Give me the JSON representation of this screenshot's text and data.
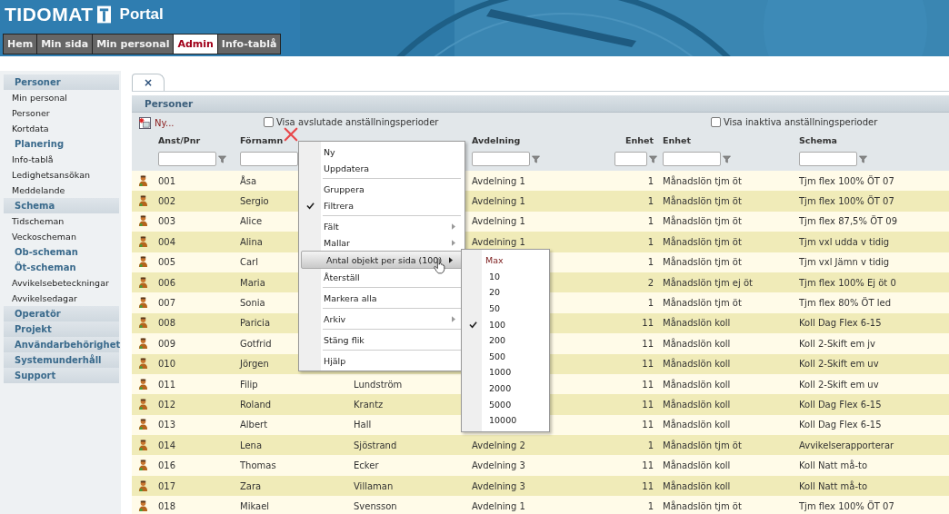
{
  "header": {
    "brand": "TIDOMAT",
    "product": "Portal"
  },
  "nav": [
    {
      "label": "Hem",
      "selected": false
    },
    {
      "label": "Min sida",
      "selected": false
    },
    {
      "label": "Min personal",
      "selected": false
    },
    {
      "label": "Admin",
      "selected": true
    },
    {
      "label": "Info-tablå",
      "selected": false
    }
  ],
  "sidebar": {
    "items": [
      {
        "kind": "section",
        "label": "Personer"
      },
      {
        "kind": "item",
        "label": "Min personal"
      },
      {
        "kind": "item",
        "label": "Personer"
      },
      {
        "kind": "item",
        "label": "Kortdata"
      },
      {
        "kind": "heading",
        "label": "Planering"
      },
      {
        "kind": "item",
        "label": "Info-tablå"
      },
      {
        "kind": "item",
        "label": "Ledighetsansökan"
      },
      {
        "kind": "item",
        "label": "Meddelande"
      },
      {
        "kind": "section",
        "label": "Schema"
      },
      {
        "kind": "item",
        "label": "Tidscheman"
      },
      {
        "kind": "item",
        "label": "Veckoscheman"
      },
      {
        "kind": "heading",
        "label": "Ob-scheman"
      },
      {
        "kind": "heading",
        "label": "Öt-scheman"
      },
      {
        "kind": "item",
        "label": "Avvikelsebeteckningar"
      },
      {
        "kind": "item",
        "label": "Avvikelsedagar"
      },
      {
        "kind": "section",
        "label": "Operatör"
      },
      {
        "kind": "section",
        "label": "Projekt"
      },
      {
        "kind": "section",
        "label": "Användarbehörighet"
      },
      {
        "kind": "section",
        "label": "Systemunderhåll"
      },
      {
        "kind": "section",
        "label": "Support"
      }
    ]
  },
  "tab": {
    "close": "×"
  },
  "panel": {
    "title": "Personer",
    "new_label": "Ny...",
    "checkboxes": [
      {
        "label": "Visa avslutade anställningsperioder",
        "checked": false
      },
      {
        "label": "Visa inaktiva anställningsperioder",
        "checked": false
      }
    ]
  },
  "table": {
    "columns": [
      {
        "label": "Anst/Pnr"
      },
      {
        "label": "Förnamn"
      },
      {},
      {
        "label": "Avdelning"
      },
      {
        "label": "Enhet"
      },
      {
        "label": "Enhet"
      },
      {
        "label": "Schema"
      }
    ],
    "rows": [
      {
        "id": "001",
        "first": "Åsa",
        "dept": "Avdelning 1",
        "unit_no": "1",
        "unit": "Månadslön tjm öt",
        "schema": "Tjm flex 100% ÖT 07"
      },
      {
        "id": "002",
        "first": "Sergio",
        "dept": "Avdelning 1",
        "unit_no": "1",
        "unit": "Månadslön tjm öt",
        "schema": "Tjm flex 100% ÖT 07"
      },
      {
        "id": "003",
        "first": "Alice",
        "dept": "Avdelning 1",
        "unit_no": "1",
        "unit": "Månadslön tjm öt",
        "schema": "Tjm flex 87,5% ÖT 09"
      },
      {
        "id": "004",
        "first": "Alina",
        "dept": "Avdelning 1",
        "unit_no": "1",
        "unit": "Månadslön tjm öt",
        "schema": "Tjm vxl udda v tidig"
      },
      {
        "id": "005",
        "first": "Carl",
        "unit_no": "1",
        "unit": "Månadslön tjm öt",
        "schema": "Tjm vxl Jämn v tidig"
      },
      {
        "id": "006",
        "first": "Maria",
        "unit_no": "2",
        "unit": "Månadslön tjm ej öt",
        "schema": "Tjm flex 100% Ej öt 0"
      },
      {
        "id": "007",
        "first": "Sonia",
        "unit_no": "1",
        "unit": "Månadslön tjm öt",
        "schema": "Tjm flex 80% ÖT led"
      },
      {
        "id": "008",
        "first": "Paricia",
        "unit_no": "11",
        "unit": "Månadslön koll",
        "schema": "Koll Dag Flex 6-15"
      },
      {
        "id": "009",
        "first": "Gotfrid",
        "unit_no": "11",
        "unit": "Månadslön koll",
        "schema": "Koll 2-Skift em jv"
      },
      {
        "id": "010",
        "first": "Jörgen",
        "unit_no": "11",
        "unit": "Månadslön koll",
        "schema": "Koll 2-Skift em uv"
      },
      {
        "id": "011",
        "first": "Filip",
        "last": "Lundström",
        "unit_no": "11",
        "unit": "Månadslön koll",
        "schema": "Koll 2-Skift em uv"
      },
      {
        "id": "012",
        "first": "Roland",
        "last": "Krantz",
        "unit_no": "11",
        "unit": "Månadslön koll",
        "schema": "Koll Dag Flex 6-15"
      },
      {
        "id": "013",
        "first": "Albert",
        "last": "Hall",
        "unit_no": "11",
        "unit": "Månadslön koll",
        "schema": "Koll Dag Flex 6-15"
      },
      {
        "id": "014",
        "first": "Lena",
        "last": "Sjöstrand",
        "dept": "Avdelning 2",
        "unit_no": "1",
        "unit": "Månadslön tjm öt",
        "schema": "Avvikelserapporterar"
      },
      {
        "id": "016",
        "first": "Thomas",
        "last": "Ecker",
        "dept": "Avdelning 3",
        "unit_no": "11",
        "unit": "Månadslön koll",
        "schema": "Koll Natt må-to"
      },
      {
        "id": "017",
        "first": "Zara",
        "last": "Villaman",
        "dept": "Avdelning 3",
        "unit_no": "11",
        "unit": "Månadslön koll",
        "schema": "Koll Natt må-to"
      },
      {
        "id": "018",
        "first": "Mikael",
        "last": "Svensson",
        "dept": "Avdelning 1",
        "unit_no": "1",
        "unit": "Månadslön tjm öt",
        "schema": "Tjm flex 100% ÖT 07"
      }
    ]
  },
  "context_menu": {
    "items": [
      {
        "kind": "item",
        "label": "Ny",
        "checked": false,
        "submenu": false,
        "highlighted": false
      },
      {
        "kind": "item",
        "label": "Uppdatera",
        "checked": false,
        "submenu": false,
        "highlighted": false
      },
      {
        "kind": "separator"
      },
      {
        "kind": "item",
        "label": "Gruppera",
        "checked": false,
        "submenu": false,
        "highlighted": false
      },
      {
        "kind": "item",
        "label": "Filtrera",
        "checked": true,
        "submenu": false,
        "highlighted": false
      },
      {
        "kind": "separator"
      },
      {
        "kind": "item",
        "label": "Fält",
        "checked": false,
        "submenu": true,
        "highlighted": false
      },
      {
        "kind": "item",
        "label": "Mallar",
        "checked": false,
        "submenu": true,
        "highlighted": false
      },
      {
        "kind": "item",
        "label": "Antal objekt per sida (100)",
        "checked": false,
        "submenu": true,
        "highlighted": true
      },
      {
        "kind": "item",
        "label": "Återställ",
        "checked": false,
        "submenu": false,
        "highlighted": false
      },
      {
        "kind": "separator"
      },
      {
        "kind": "item",
        "label": "Markera alla",
        "checked": false,
        "submenu": false,
        "highlighted": false
      },
      {
        "kind": "separator"
      },
      {
        "kind": "item",
        "label": "Arkiv",
        "checked": false,
        "submenu": true,
        "highlighted": false
      },
      {
        "kind": "separator"
      },
      {
        "kind": "item",
        "label": "Stäng flik",
        "checked": false,
        "submenu": false,
        "highlighted": false
      },
      {
        "kind": "separator"
      },
      {
        "kind": "item",
        "label": "Hjälp",
        "checked": false,
        "submenu": false,
        "highlighted": false
      }
    ],
    "submenu": [
      {
        "label": "Max",
        "selected": false,
        "highlighted": true
      },
      {
        "label": "10",
        "selected": false,
        "highlighted": false
      },
      {
        "label": "20",
        "selected": false,
        "highlighted": false
      },
      {
        "label": "50",
        "selected": false,
        "highlighted": false
      },
      {
        "label": "100",
        "selected": true,
        "highlighted": false
      },
      {
        "label": "200",
        "selected": false,
        "highlighted": false
      },
      {
        "label": "500",
        "selected": false,
        "highlighted": false
      },
      {
        "label": "1000",
        "selected": false,
        "highlighted": false
      },
      {
        "label": "2000",
        "selected": false,
        "highlighted": false
      },
      {
        "label": "5000",
        "selected": false,
        "highlighted": false
      },
      {
        "label": "10000",
        "selected": false,
        "highlighted": false
      }
    ]
  }
}
